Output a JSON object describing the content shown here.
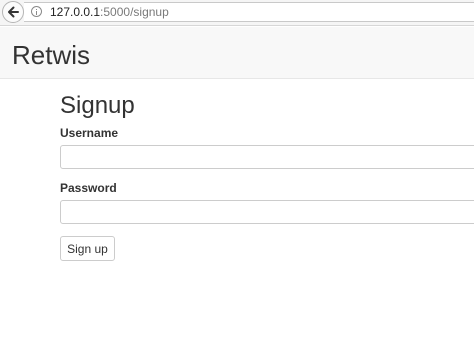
{
  "browser": {
    "back_icon": "arrow-left-icon",
    "info_icon": "info-icon",
    "url_host": "127.0.0.1",
    "url_path": ":5000/signup"
  },
  "navbar": {
    "brand": "Retwis"
  },
  "form": {
    "title": "Signup",
    "username_label": "Username",
    "username_value": "",
    "password_label": "Password",
    "password_value": "",
    "submit_label": "Sign up"
  }
}
